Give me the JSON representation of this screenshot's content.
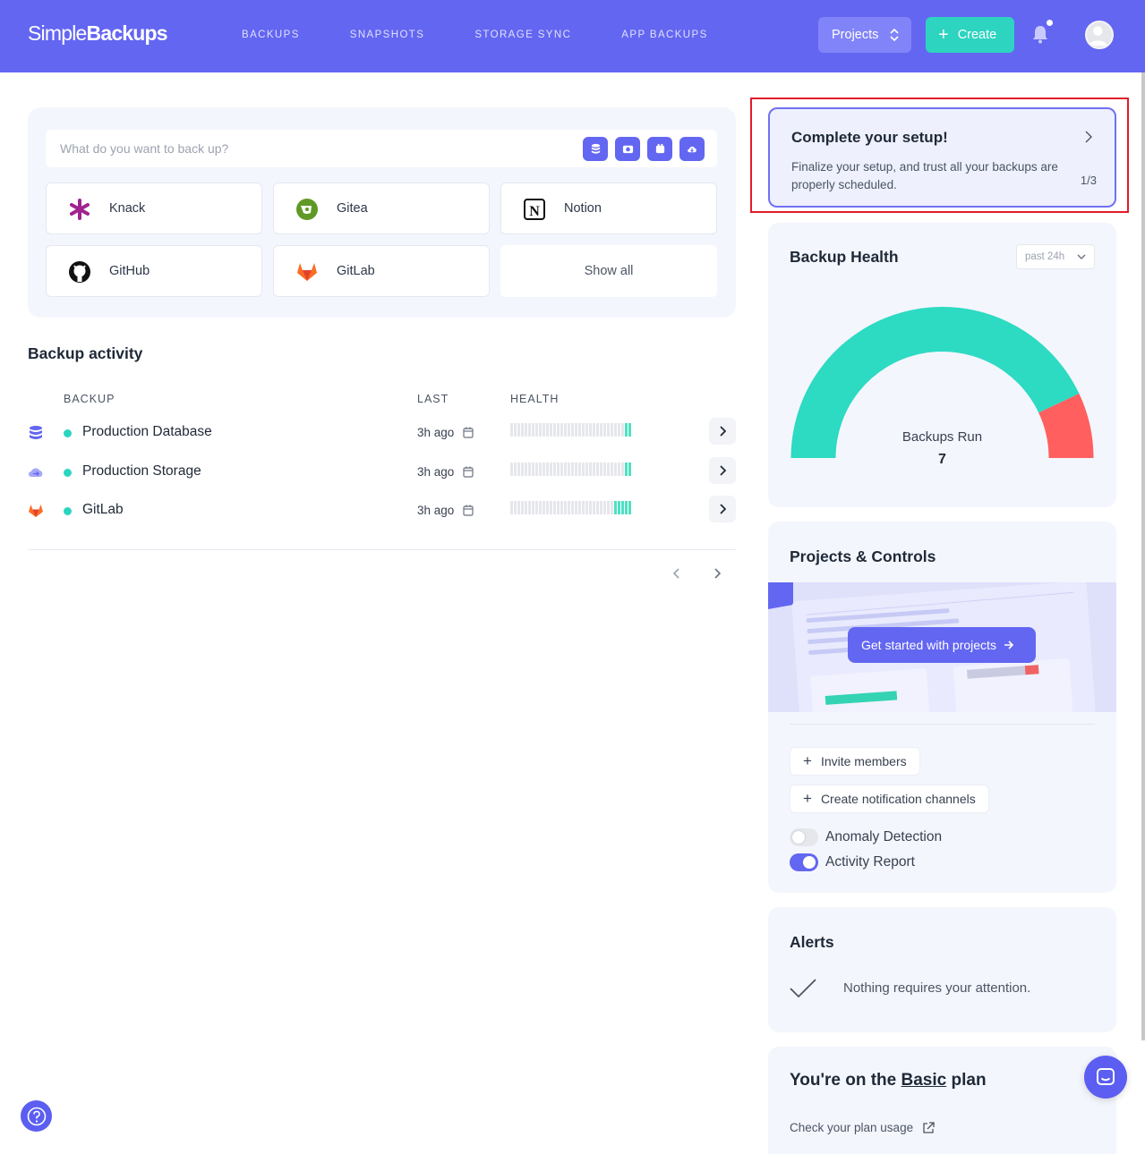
{
  "header": {
    "logo_prefix": "Simple",
    "logo_bold": "Backups",
    "nav": [
      "BACKUPS",
      "SNAPSHOTS",
      "STORAGE SYNC",
      "APP BACKUPS"
    ],
    "projects_label": "Projects",
    "create_label": "Create",
    "accent_color": "#6366f1",
    "create_color": "#2dd4bf"
  },
  "quick_start": {
    "search_placeholder": "What do you want to back up?",
    "search_icons": [
      "database-icon",
      "camera-icon",
      "storage-icon",
      "cloud-icon"
    ],
    "tiles": [
      {
        "label": "Knack",
        "icon": "knack-icon"
      },
      {
        "label": "Gitea",
        "icon": "gitea-icon"
      },
      {
        "label": "Notion",
        "icon": "notion-icon"
      },
      {
        "label": "GitHub",
        "icon": "github-icon"
      },
      {
        "label": "GitLab",
        "icon": "gitlab-icon"
      }
    ],
    "show_all_label": "Show all"
  },
  "activity": {
    "title": "Backup activity",
    "columns": {
      "backup": "BACKUP",
      "last": "LAST",
      "health": "HEALTH"
    },
    "rows": [
      {
        "name": "Production Database",
        "last": "3h ago",
        "icon": "database-icon",
        "status_color": "#2dd4bf",
        "health_ok_count": 2
      },
      {
        "name": "Production Storage",
        "last": "3h ago",
        "icon": "cloud-storage-icon",
        "status_color": "#2dd4bf",
        "health_ok_count": 2
      },
      {
        "name": "GitLab",
        "last": "3h ago",
        "icon": "gitlab-icon",
        "status_color": "#2dd4bf",
        "health_ok_count": 5
      }
    ]
  },
  "setup": {
    "title": "Complete your setup!",
    "description": "Finalize your setup, and trust all your backups are properly scheduled.",
    "progress": "1/3"
  },
  "health": {
    "title": "Backup Health",
    "period": "past 24h",
    "gauge_label": "Backups Run",
    "gauge_value": "7",
    "success_fraction": 0.86,
    "success_color": "#2ddac2",
    "failure_color": "#ff5f5f"
  },
  "projects_controls": {
    "title": "Projects & Controls",
    "cta_label": "Get started with projects",
    "invite_label": "Invite members",
    "notification_label": "Create notification channels",
    "toggles": [
      {
        "label": "Anomaly Detection",
        "on": false
      },
      {
        "label": "Activity Report",
        "on": true
      }
    ]
  },
  "alerts": {
    "title": "Alerts",
    "message": "Nothing requires your attention."
  },
  "plan": {
    "title_prefix": "You're on the ",
    "plan_name": "Basic",
    "title_suffix": " plan",
    "usage_link": "Check your plan usage"
  }
}
